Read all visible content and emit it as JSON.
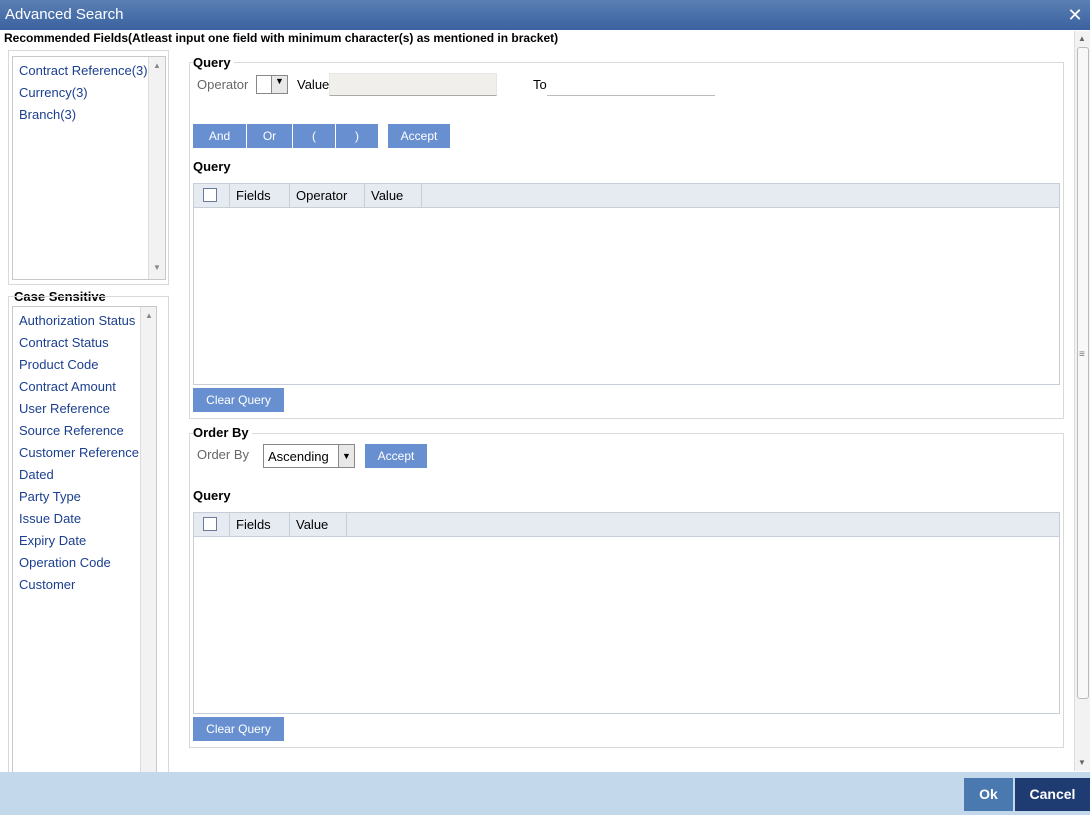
{
  "window": {
    "title": "Advanced Search",
    "close_glyph": "✕"
  },
  "recommended": {
    "heading": "Recommended Fields(Atleast input one field with minimum character(s) as mentioned in bracket)",
    "items": [
      "Contract Reference(3)",
      "Currency(3)",
      "Branch(3)"
    ]
  },
  "case_sensitive": {
    "heading": "Case Sensitive",
    "items": [
      "Authorization Status",
      "Contract Status",
      "Product Code",
      "Contract Amount",
      "User Reference",
      "Source Reference",
      "Customer Reference",
      "Dated",
      "Party Type",
      "Issue Date",
      "Expiry Date",
      "Operation Code",
      "Customer"
    ]
  },
  "query": {
    "heading": "Query",
    "operator_label": "Operator",
    "operator_value": "",
    "value_label": "Value",
    "value_input": "",
    "to_label": "To",
    "to_input": "",
    "buttons": {
      "and": "And",
      "or": "Or",
      "open": "(",
      "close": ")",
      "accept": "Accept"
    },
    "grid_heading": "Query",
    "columns": [
      "Fields",
      "Operator",
      "Value"
    ],
    "clear": "Clear Query"
  },
  "order_by": {
    "heading": "Order By",
    "label": "Order By",
    "selected": "Ascending",
    "accept": "Accept",
    "grid_heading": "Query",
    "columns": [
      "Fields",
      "Value"
    ],
    "clear": "Clear Query"
  },
  "footer": {
    "ok": "Ok",
    "cancel": "Cancel"
  },
  "colors": {
    "titlebar": "#3b62a0",
    "button": "#6890d0",
    "footer": "#c4d8ec",
    "footer_button": "#4a79b0",
    "cancel_button": "#1e3c72",
    "link": "#1b3f8f"
  }
}
